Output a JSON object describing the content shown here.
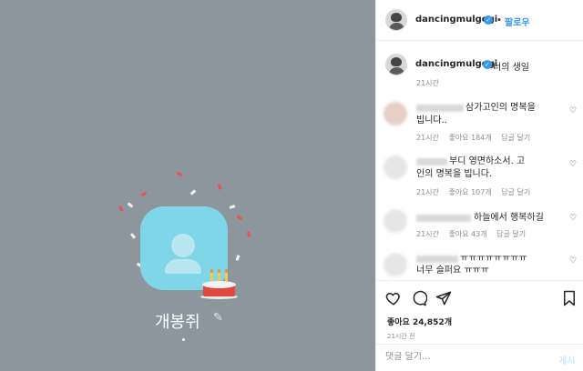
{
  "media": {
    "profile_name": "개봉쥐",
    "edit_icon": "pencil-icon",
    "avatar_icon": "person-icon",
    "cake_icon": "birthday-cake-icon",
    "background_color": "#8c969c",
    "bubble_color": "#7fd6e8"
  },
  "header": {
    "username": "dancingmulgogi",
    "verified": true,
    "separator": "•",
    "follow_label": "팔로우"
  },
  "caption": {
    "username": "dancingmulgogi",
    "text": "너의 생일",
    "time": "21시간"
  },
  "comments": [
    {
      "text_line1": "삼가고인의 명복을",
      "text_line2": "빕니다..",
      "time": "21시간",
      "likes": "좋아요 184개",
      "reply": "답글 달기"
    },
    {
      "text_line1": "부디 영면하소서. 고",
      "text_line2": "인의 명복을 빕니다.",
      "time": "21시간",
      "likes": "좋아요 107개",
      "reply": "답글 달기"
    },
    {
      "text_line1": "하늘에서 행복하길",
      "text_line2": "",
      "time": "21시간",
      "likes": "좋아요 43개",
      "reply": "답글 달기"
    },
    {
      "text_line1": "ㅠㅠㅠㅠㅠㅠㅠㅠ",
      "text_line2": "너무 슬퍼요 ㅠㅠㅠ",
      "time": "",
      "likes": "",
      "reply": ""
    }
  ],
  "actions": {
    "like_icon": "heart-icon",
    "comment_icon": "comment-icon",
    "share_icon": "send-icon",
    "save_icon": "bookmark-icon",
    "likes_text": "좋아요 24,852개",
    "post_time": "21시간 전"
  },
  "comment_box": {
    "placeholder": "댓글 달기...",
    "post_label": "게시"
  },
  "colors": {
    "accent": "#3897f0",
    "muted": "#8e8e8e",
    "post_disabled": "#b2dffc"
  }
}
